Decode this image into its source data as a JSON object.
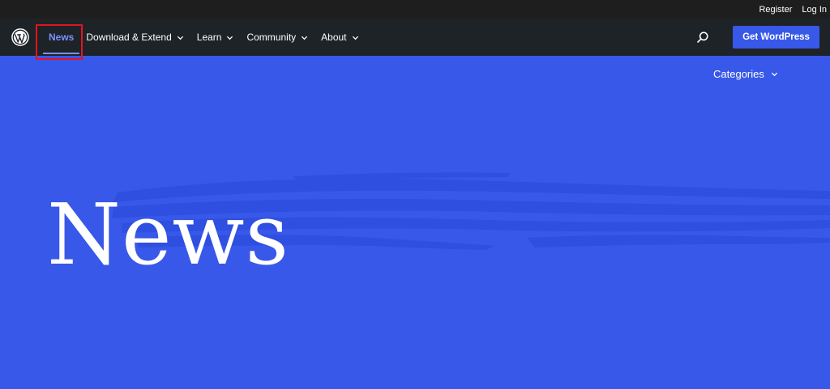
{
  "topbar": {
    "register": "Register",
    "login": "Log In"
  },
  "nav": {
    "items": [
      {
        "label": "News",
        "active": true
      },
      {
        "label": "Download & Extend"
      },
      {
        "label": "Learn"
      },
      {
        "label": "Community"
      },
      {
        "label": "About"
      }
    ],
    "cta": "Get WordPress"
  },
  "categories": {
    "label": "Categories"
  },
  "hero": {
    "title": "News"
  },
  "colors": {
    "accent": "#3858e9",
    "active_link": "#7b90ff",
    "nav_bg": "#1e2327",
    "topbar_bg": "#1e1e1e",
    "highlight": "#e3141e"
  },
  "icons": {
    "logo": "wordpress-logo-icon",
    "search": "search-icon",
    "chevron": "chevron-down-icon"
  }
}
